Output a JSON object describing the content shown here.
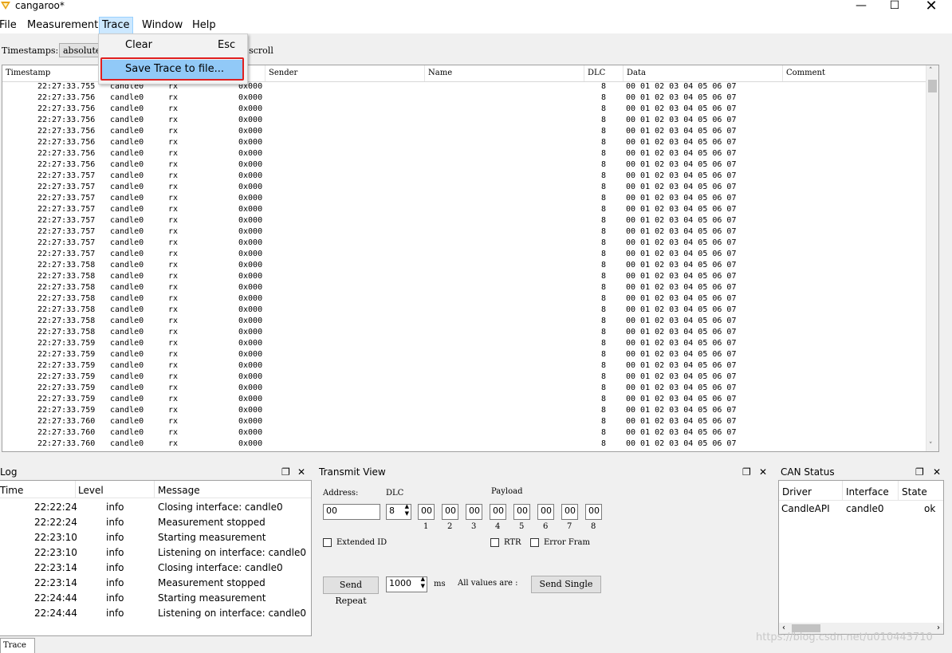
{
  "window": {
    "title": "cangaroo*"
  },
  "menubar": {
    "items": [
      "File",
      "Measurement",
      "Trace",
      "Window",
      "Help"
    ]
  },
  "trace_menu": {
    "clear_label": "Clear",
    "clear_shortcut": "Esc",
    "save_label": "Save Trace to file..."
  },
  "toolbar": {
    "timestamps_label": "Timestamps:",
    "timestamps_value": "absolute",
    "autoscroll_label": "o scroll"
  },
  "trace": {
    "columns": [
      "Timestamp",
      "",
      "",
      "",
      "Sender",
      "Name",
      "DLC",
      "Data",
      "Comment"
    ],
    "interface": "candle0",
    "direction": "rx",
    "id": "0x000",
    "dlc": "8",
    "data": "00 01 02 03 04 05 06 07",
    "timestamps": [
      "22:27:33.755",
      "22:27:33.756",
      "22:27:33.756",
      "22:27:33.756",
      "22:27:33.756",
      "22:27:33.756",
      "22:27:33.756",
      "22:27:33.756",
      "22:27:33.757",
      "22:27:33.757",
      "22:27:33.757",
      "22:27:33.757",
      "22:27:33.757",
      "22:27:33.757",
      "22:27:33.757",
      "22:27:33.757",
      "22:27:33.758",
      "22:27:33.758",
      "22:27:33.758",
      "22:27:33.758",
      "22:27:33.758",
      "22:27:33.758",
      "22:27:33.758",
      "22:27:33.759",
      "22:27:33.759",
      "22:27:33.759",
      "22:27:33.759",
      "22:27:33.759",
      "22:27:33.759",
      "22:27:33.759",
      "22:27:33.760",
      "22:27:33.760",
      "22:27:33.760"
    ]
  },
  "log": {
    "title": "Log",
    "columns": [
      "Time",
      "Level",
      "Message"
    ],
    "rows": [
      {
        "time": "22:22:24",
        "level": "info",
        "message": "Closing interface: candle0"
      },
      {
        "time": "22:22:24",
        "level": "info",
        "message": "Measurement stopped"
      },
      {
        "time": "22:23:10",
        "level": "info",
        "message": "Starting measurement"
      },
      {
        "time": "22:23:10",
        "level": "info",
        "message": "Listening on interface: candle0"
      },
      {
        "time": "22:23:14",
        "level": "info",
        "message": "Closing interface: candle0"
      },
      {
        "time": "22:23:14",
        "level": "info",
        "message": "Measurement stopped"
      },
      {
        "time": "22:24:44",
        "level": "info",
        "message": "Starting measurement"
      },
      {
        "time": "22:24:44",
        "level": "info",
        "message": "Listening on interface: candle0"
      }
    ]
  },
  "transmit": {
    "title": "Transmit View",
    "address_label": "Address:",
    "address_value": "00",
    "dlc_label": "DLC",
    "dlc_value": "8",
    "payload_label": "Payload",
    "payload": [
      "00",
      "00",
      "00",
      "00",
      "00",
      "00",
      "00",
      "00"
    ],
    "payload_index": [
      "1",
      "2",
      "3",
      "4",
      "5",
      "6",
      "7",
      "8"
    ],
    "extended_label": "Extended ID",
    "rtr_label": "RTR",
    "error_label": "Error Fram",
    "send_repeat_label": "Send Repeat",
    "interval_value": "1000",
    "ms_label": "ms",
    "all_values_label": "All values are :",
    "send_single_label": "Send Single"
  },
  "can_status": {
    "title": "CAN Status",
    "columns": [
      "Driver",
      "Interface",
      "State"
    ],
    "row": {
      "driver": "CandleAPI",
      "interface": "candle0",
      "state": "ok"
    }
  },
  "bottom_tab": {
    "label": "Trace"
  },
  "watermark": "https://blog.csdn.net/u010443710"
}
